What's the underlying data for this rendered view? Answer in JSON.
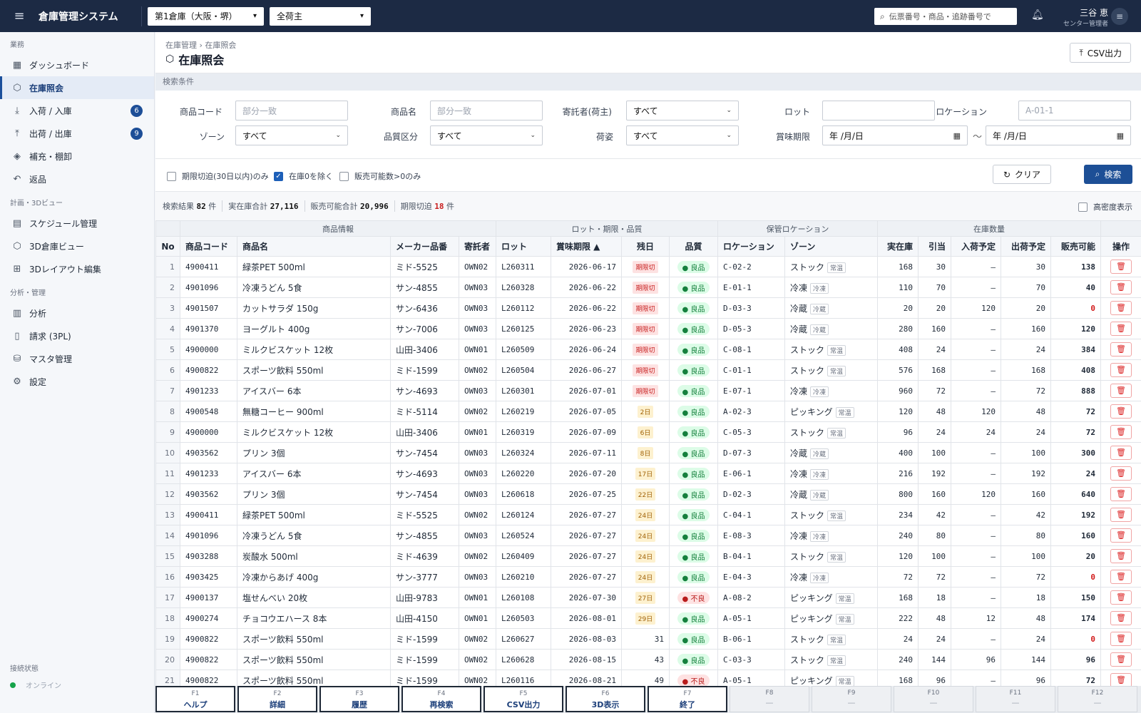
{
  "app": {
    "title": "倉庫管理システム",
    "warehouse": "第1倉庫（大阪・堺）",
    "owner_filter": "全荷主",
    "search_placeholder": "伝票番号・商品・追跡番号で",
    "user_name": "三谷 恵",
    "user_role": "センター管理者"
  },
  "sidebar": {
    "sections": [
      {
        "label": "業務",
        "items": [
          {
            "label": "ダッシュボード",
            "icon": "grid-icon",
            "glyph": "▦",
            "badge": "",
            "active": false
          },
          {
            "label": "在庫照会",
            "icon": "box-icon",
            "glyph": "⬡",
            "badge": "",
            "active": true
          },
          {
            "label": "入荷 / 入庫",
            "icon": "download-icon",
            "glyph": "⤓",
            "badge": "6",
            "active": false
          },
          {
            "label": "出荷 / 出庫",
            "icon": "upload-icon",
            "glyph": "⤒",
            "badge": "9",
            "active": false
          },
          {
            "label": "補充・棚卸",
            "icon": "layers-icon",
            "glyph": "◈",
            "badge": "",
            "active": false
          },
          {
            "label": "返品",
            "icon": "undo-icon",
            "glyph": "↶",
            "badge": "",
            "active": false
          }
        ]
      },
      {
        "label": "計画・3Dビュー",
        "items": [
          {
            "label": "スケジュール管理",
            "icon": "calendar-icon",
            "glyph": "▤",
            "badge": "",
            "active": false
          },
          {
            "label": "3D倉庫ビュー",
            "icon": "cube-icon",
            "glyph": "⬡",
            "badge": "",
            "active": false
          },
          {
            "label": "3Dレイアウト編集",
            "icon": "table-icon",
            "glyph": "⊞",
            "badge": "",
            "active": false
          }
        ]
      },
      {
        "label": "分析・管理",
        "items": [
          {
            "label": "分析",
            "icon": "bar-chart-icon",
            "glyph": "▥",
            "badge": "",
            "active": false
          },
          {
            "label": "請求 (3PL)",
            "icon": "file-icon",
            "glyph": "▯",
            "badge": "",
            "active": false
          },
          {
            "label": "マスタ管理",
            "icon": "database-icon",
            "glyph": "⛁",
            "badge": "",
            "active": false
          },
          {
            "label": "設定",
            "icon": "gear-icon",
            "glyph": "⚙",
            "badge": "",
            "active": false
          }
        ]
      }
    ],
    "connection_label": "接続状態",
    "connection_status": "オンライン"
  },
  "page": {
    "breadcrumb": "在庫管理 › 在庫照会",
    "title": "在庫照会",
    "csv_button": "CSV出力"
  },
  "conditions": {
    "title": "検索条件",
    "item_code_label": "商品コード",
    "item_code_placeholder": "部分一致",
    "item_name_label": "商品名",
    "item_name_placeholder": "部分一致",
    "owner_label": "寄託者(荷主)",
    "owner_value": "すべて",
    "lot_label": "ロット",
    "lot_value": "",
    "location_label": "ロケーション",
    "location_placeholder": "A-01-1",
    "zone_label": "ゾーン",
    "zone_value": "すべて",
    "quality_label": "品質区分",
    "quality_value": "すべて",
    "packing_label": "荷姿",
    "packing_value": "すべて",
    "best_before_label": "賞味期限",
    "date_from": "年 /月/日",
    "date_to": "年 /月/日",
    "range_sep": "〜"
  },
  "options": {
    "expiring": {
      "label": "期限切迫(30日以内)のみ",
      "checked": false
    },
    "exclude_zero": {
      "label": "在庫0を除く",
      "checked": true
    },
    "sellable_only": {
      "label": "販売可能数>0のみ",
      "checked": false
    },
    "clear_button": "クリア",
    "search_button": "検索"
  },
  "summary": {
    "results_label": "検索結果",
    "results_count": "82",
    "results_unit": "件",
    "stock_total_label": "実在庫合計",
    "stock_total": "27,116",
    "sellable_total_label": "販売可能合計",
    "sellable_total": "20,996",
    "expiring_label": "期限切迫",
    "expiring_count": "18",
    "expiring_unit": "件",
    "high_density_label": "高密度表示"
  },
  "table": {
    "groups": {
      "product": "商品情報",
      "lot": "ロット・期限・品質",
      "location": "保管ロケーション",
      "qty": "在庫数量"
    },
    "columns": {
      "no": "No",
      "code": "商品コード",
      "name": "商品名",
      "maker": "メーカー品番",
      "owner": "寄託者",
      "lot": "ロット",
      "expiry": "賞味期限 ▲",
      "days": "残日",
      "quality": "品質",
      "location": "ロケーション",
      "zone": "ゾーン",
      "stock": "実在庫",
      "alloc": "引当",
      "inbound": "入荷予定",
      "outbound": "出荷予定",
      "available": "販売可能",
      "action": "操作"
    },
    "delete_icon": "trash-icon",
    "rows": [
      {
        "no": "1",
        "code": "4900411",
        "name": "緑茶PET 500ml",
        "maker": "ミド-5525",
        "owner": "OWN02",
        "lot": "L260311",
        "expiry": "2026-06-17",
        "days": "期限切",
        "days_style": "red",
        "quality": "良品",
        "q_style": "good",
        "location": "C-02-2",
        "zone": "ストック",
        "zone_tag": "常温",
        "stock": "168",
        "alloc": "30",
        "inbound": "–",
        "outbound": "30",
        "available": "138"
      },
      {
        "no": "2",
        "code": "4901096",
        "name": "冷凍うどん 5食",
        "maker": "サン-4855",
        "owner": "OWN03",
        "lot": "L260328",
        "expiry": "2026-06-22",
        "days": "期限切",
        "days_style": "red",
        "quality": "良品",
        "q_style": "good",
        "location": "E-01-1",
        "zone": "冷凍",
        "zone_tag": "冷凍",
        "stock": "110",
        "alloc": "70",
        "inbound": "–",
        "outbound": "70",
        "available": "40"
      },
      {
        "no": "3",
        "code": "4901507",
        "name": "カットサラダ 150g",
        "maker": "サン-6436",
        "owner": "OWN03",
        "lot": "L260112",
        "expiry": "2026-06-22",
        "days": "期限切",
        "days_style": "red",
        "quality": "良品",
        "q_style": "good",
        "location": "D-03-3",
        "zone": "冷蔵",
        "zone_tag": "冷蔵",
        "stock": "20",
        "alloc": "20",
        "inbound": "120",
        "outbound": "20",
        "available": "0"
      },
      {
        "no": "4",
        "code": "4901370",
        "name": "ヨーグルト 400g",
        "maker": "サン-7006",
        "owner": "OWN03",
        "lot": "L260125",
        "expiry": "2026-06-23",
        "days": "期限切",
        "days_style": "red",
        "quality": "良品",
        "q_style": "good",
        "location": "D-05-3",
        "zone": "冷蔵",
        "zone_tag": "冷蔵",
        "stock": "280",
        "alloc": "160",
        "inbound": "–",
        "outbound": "160",
        "available": "120"
      },
      {
        "no": "5",
        "code": "4900000",
        "name": "ミルクビスケット 12枚",
        "maker": "山田-3406",
        "owner": "OWN01",
        "lot": "L260509",
        "expiry": "2026-06-24",
        "days": "期限切",
        "days_style": "red",
        "quality": "良品",
        "q_style": "good",
        "location": "C-08-1",
        "zone": "ストック",
        "zone_tag": "常温",
        "stock": "408",
        "alloc": "24",
        "inbound": "–",
        "outbound": "24",
        "available": "384"
      },
      {
        "no": "6",
        "code": "4900822",
        "name": "スポーツ飲料 550ml",
        "maker": "ミド-1599",
        "owner": "OWN02",
        "lot": "L260504",
        "expiry": "2026-06-27",
        "days": "期限切",
        "days_style": "red",
        "quality": "良品",
        "q_style": "good",
        "location": "C-01-1",
        "zone": "ストック",
        "zone_tag": "常温",
        "stock": "576",
        "alloc": "168",
        "inbound": "–",
        "outbound": "168",
        "available": "408"
      },
      {
        "no": "7",
        "code": "4901233",
        "name": "アイスバー 6本",
        "maker": "サン-4693",
        "owner": "OWN03",
        "lot": "L260301",
        "expiry": "2026-07-01",
        "days": "期限切",
        "days_style": "red",
        "quality": "良品",
        "q_style": "good",
        "location": "E-07-1",
        "zone": "冷凍",
        "zone_tag": "冷凍",
        "stock": "960",
        "alloc": "72",
        "inbound": "–",
        "outbound": "72",
        "available": "888"
      },
      {
        "no": "8",
        "code": "4900548",
        "name": "無糖コーヒー 900ml",
        "maker": "ミド-5114",
        "owner": "OWN02",
        "lot": "L260219",
        "expiry": "2026-07-05",
        "days": "2日",
        "days_style": "amber",
        "quality": "良品",
        "q_style": "good",
        "location": "A-02-3",
        "zone": "ピッキング",
        "zone_tag": "常温",
        "stock": "120",
        "alloc": "48",
        "inbound": "120",
        "outbound": "48",
        "available": "72"
      },
      {
        "no": "9",
        "code": "4900000",
        "name": "ミルクビスケット 12枚",
        "maker": "山田-3406",
        "owner": "OWN01",
        "lot": "L260319",
        "expiry": "2026-07-09",
        "days": "6日",
        "days_style": "amber",
        "quality": "良品",
        "q_style": "good",
        "location": "C-05-3",
        "zone": "ストック",
        "zone_tag": "常温",
        "stock": "96",
        "alloc": "24",
        "inbound": "24",
        "outbound": "24",
        "available": "72"
      },
      {
        "no": "10",
        "code": "4903562",
        "name": "プリン 3個",
        "maker": "サン-7454",
        "owner": "OWN03",
        "lot": "L260324",
        "expiry": "2026-07-11",
        "days": "8日",
        "days_style": "amber",
        "quality": "良品",
        "q_style": "good",
        "location": "D-07-3",
        "zone": "冷蔵",
        "zone_tag": "冷蔵",
        "stock": "400",
        "alloc": "100",
        "inbound": "–",
        "outbound": "100",
        "available": "300"
      },
      {
        "no": "11",
        "code": "4901233",
        "name": "アイスバー 6本",
        "maker": "サン-4693",
        "owner": "OWN03",
        "lot": "L260220",
        "expiry": "2026-07-20",
        "days": "17日",
        "days_style": "amber",
        "quality": "良品",
        "q_style": "good",
        "location": "E-06-1",
        "zone": "冷凍",
        "zone_tag": "冷凍",
        "stock": "216",
        "alloc": "192",
        "inbound": "–",
        "outbound": "192",
        "available": "24"
      },
      {
        "no": "12",
        "code": "4903562",
        "name": "プリン 3個",
        "maker": "サン-7454",
        "owner": "OWN03",
        "lot": "L260618",
        "expiry": "2026-07-25",
        "days": "22日",
        "days_style": "amber",
        "quality": "良品",
        "q_style": "good",
        "location": "D-02-3",
        "zone": "冷蔵",
        "zone_tag": "冷蔵",
        "stock": "800",
        "alloc": "160",
        "inbound": "120",
        "outbound": "160",
        "available": "640"
      },
      {
        "no": "13",
        "code": "4900411",
        "name": "緑茶PET 500ml",
        "maker": "ミド-5525",
        "owner": "OWN02",
        "lot": "L260124",
        "expiry": "2026-07-27",
        "days": "24日",
        "days_style": "amber",
        "quality": "良品",
        "q_style": "good",
        "location": "C-04-1",
        "zone": "ストック",
        "zone_tag": "常温",
        "stock": "234",
        "alloc": "42",
        "inbound": "–",
        "outbound": "42",
        "available": "192"
      },
      {
        "no": "14",
        "code": "4901096",
        "name": "冷凍うどん 5食",
        "maker": "サン-4855",
        "owner": "OWN03",
        "lot": "L260524",
        "expiry": "2026-07-27",
        "days": "24日",
        "days_style": "amber",
        "quality": "良品",
        "q_style": "good",
        "location": "E-08-3",
        "zone": "冷凍",
        "zone_tag": "冷凍",
        "stock": "240",
        "alloc": "80",
        "inbound": "–",
        "outbound": "80",
        "available": "160"
      },
      {
        "no": "15",
        "code": "4903288",
        "name": "炭酸水 500ml",
        "maker": "ミド-4639",
        "owner": "OWN02",
        "lot": "L260409",
        "expiry": "2026-07-27",
        "days": "24日",
        "days_style": "amber",
        "quality": "良品",
        "q_style": "good",
        "location": "B-04-1",
        "zone": "ストック",
        "zone_tag": "常温",
        "stock": "120",
        "alloc": "100",
        "inbound": "–",
        "outbound": "100",
        "available": "20"
      },
      {
        "no": "16",
        "code": "4903425",
        "name": "冷凍からあげ 400g",
        "maker": "サン-3777",
        "owner": "OWN03",
        "lot": "L260210",
        "expiry": "2026-07-27",
        "days": "24日",
        "days_style": "amber",
        "quality": "良品",
        "q_style": "good",
        "location": "E-04-3",
        "zone": "冷凍",
        "zone_tag": "冷凍",
        "stock": "72",
        "alloc": "72",
        "inbound": "–",
        "outbound": "72",
        "available": "0"
      },
      {
        "no": "17",
        "code": "4900137",
        "name": "塩せんべい 20枚",
        "maker": "山田-9783",
        "owner": "OWN01",
        "lot": "L260108",
        "expiry": "2026-07-30",
        "days": "27日",
        "days_style": "amber",
        "quality": "不良",
        "q_style": "bad",
        "location": "A-08-2",
        "zone": "ピッキング",
        "zone_tag": "常温",
        "stock": "168",
        "alloc": "18",
        "inbound": "–",
        "outbound": "18",
        "available": "150"
      },
      {
        "no": "18",
        "code": "4900274",
        "name": "チョコウエハース 8本",
        "maker": "山田-4150",
        "owner": "OWN01",
        "lot": "L260503",
        "expiry": "2026-08-01",
        "days": "29日",
        "days_style": "amber",
        "quality": "良品",
        "q_style": "good",
        "location": "A-05-1",
        "zone": "ピッキング",
        "zone_tag": "常温",
        "stock": "222",
        "alloc": "48",
        "inbound": "12",
        "outbound": "48",
        "available": "174"
      },
      {
        "no": "19",
        "code": "4900822",
        "name": "スポーツ飲料 550ml",
        "maker": "ミド-1599",
        "owner": "OWN02",
        "lot": "L260627",
        "expiry": "2026-08-03",
        "days": "31",
        "days_style": "plain",
        "quality": "良品",
        "q_style": "good",
        "location": "B-06-1",
        "zone": "ストック",
        "zone_tag": "常温",
        "stock": "24",
        "alloc": "24",
        "inbound": "–",
        "outbound": "24",
        "available": "0"
      },
      {
        "no": "20",
        "code": "4900822",
        "name": "スポーツ飲料 550ml",
        "maker": "ミド-1599",
        "owner": "OWN02",
        "lot": "L260628",
        "expiry": "2026-08-15",
        "days": "43",
        "days_style": "plain",
        "quality": "良品",
        "q_style": "good",
        "location": "C-03-3",
        "zone": "ストック",
        "zone_tag": "常温",
        "stock": "240",
        "alloc": "144",
        "inbound": "96",
        "outbound": "144",
        "available": "96"
      },
      {
        "no": "21",
        "code": "4900822",
        "name": "スポーツ飲料 550ml",
        "maker": "ミド-1599",
        "owner": "OWN02",
        "lot": "L260116",
        "expiry": "2026-08-21",
        "days": "49",
        "days_style": "plain",
        "quality": "不良",
        "q_style": "bad",
        "location": "A-05-1",
        "zone": "ピッキング",
        "zone_tag": "常温",
        "stock": "168",
        "alloc": "96",
        "inbound": "–",
        "outbound": "96",
        "available": "72"
      }
    ]
  },
  "fkeys": [
    {
      "key": "F1",
      "label": "ヘルプ",
      "enabled": true
    },
    {
      "key": "F2",
      "label": "詳細",
      "enabled": true
    },
    {
      "key": "F3",
      "label": "履歴",
      "enabled": true
    },
    {
      "key": "F4",
      "label": "再検索",
      "enabled": true
    },
    {
      "key": "F5",
      "label": "CSV出力",
      "enabled": true
    },
    {
      "key": "F6",
      "label": "3D表示",
      "enabled": true
    },
    {
      "key": "F7",
      "label": "終了",
      "enabled": true
    },
    {
      "key": "F8",
      "label": "—",
      "enabled": false
    },
    {
      "key": "F9",
      "label": "—",
      "enabled": false
    },
    {
      "key": "F10",
      "label": "—",
      "enabled": false
    },
    {
      "key": "F11",
      "label": "—",
      "enabled": false
    },
    {
      "key": "F12",
      "label": "—",
      "enabled": false
    }
  ]
}
